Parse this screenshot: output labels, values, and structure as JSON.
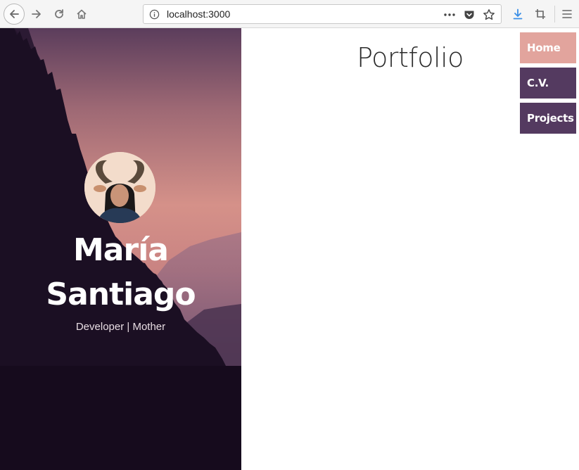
{
  "browser": {
    "url": "localhost:3000",
    "icons": [
      "back-icon",
      "forward-icon",
      "reload-icon",
      "home-icon",
      "info-icon",
      "more-icon",
      "pocket-icon",
      "bookmark-star-icon",
      "download-icon",
      "screenshot-icon",
      "menu-icon"
    ]
  },
  "hero": {
    "name_line1": "María",
    "name_line2": "Santiago",
    "tagline": "Developer | Mother"
  },
  "page": {
    "title": "Portfolio"
  },
  "nav": {
    "items": [
      {
        "label": "Home",
        "active": true
      },
      {
        "label": "C.V.",
        "active": false
      },
      {
        "label": "Projects",
        "active": false
      }
    ]
  },
  "colors": {
    "nav_active": "#e2a49d",
    "nav_default": "#543a60"
  }
}
